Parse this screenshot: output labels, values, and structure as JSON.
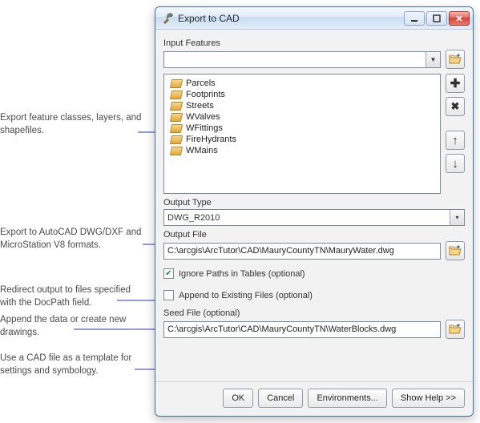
{
  "annotations": {
    "a1": "Export feature classes, layers, and shapefiles.",
    "a2": "Export to AutoCAD DWG/DXF and MicroStation V8 formats.",
    "a3": "Redirect output to files specified with the DocPath field.",
    "a4": "Append the data or create new drawings.",
    "a5": "Use a CAD file as a template for settings and symbology."
  },
  "window": {
    "title": "Export to CAD"
  },
  "labels": {
    "input_features": "Input Features",
    "output_type": "Output Type",
    "output_file": "Output File",
    "ignore_paths": "Ignore Paths in Tables (optional)",
    "append": "Append to Existing Files (optional)",
    "seed_file": "Seed File (optional)"
  },
  "glyphs": {
    "plus": "✚",
    "x": "✖",
    "up": "↑",
    "down": "↓",
    "check": "✔"
  },
  "features": [
    "Parcels",
    "Footprints",
    "Streets",
    "WValves",
    "WFittings",
    "FireHydrants",
    "WMains"
  ],
  "output_type_value": "DWG_R2010",
  "output_file_value": "C:\\arcgis\\ArcTutor\\CAD\\MauryCountyTN\\MauryWater.dwg",
  "seed_file_value": "C:\\arcgis\\ArcTutor\\CAD\\MauryCountyTN\\WaterBlocks.dwg",
  "ignore_paths_checked": true,
  "append_checked": false,
  "buttons": {
    "ok": "OK",
    "cancel": "Cancel",
    "env": "Environments...",
    "help": "Show Help >>"
  }
}
